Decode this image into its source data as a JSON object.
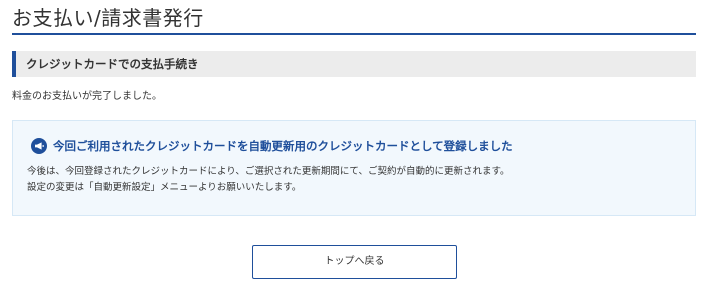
{
  "page": {
    "title": "お支払い/請求書発行"
  },
  "section": {
    "heading": "クレジットカードでの支払手続き"
  },
  "status": {
    "message": "料金のお支払いが完了しました。"
  },
  "notice": {
    "icon": "megaphone-icon",
    "heading": "今回ご利用されたクレジットカードを自動更新用のクレジットカードとして登録しました",
    "line1": "今後は、今回登録されたクレジットカードにより、ご選択された更新期間にて、ご契約が自動的に更新されます。",
    "line2": "設定の変更は「自動更新設定」メニューよりお願いいたします。"
  },
  "actions": {
    "back_to_top_label": "トップへ戻る"
  },
  "colors": {
    "accent": "#1f4f9b",
    "notice_background": "#f2f8fd",
    "section_background": "#ececec"
  }
}
